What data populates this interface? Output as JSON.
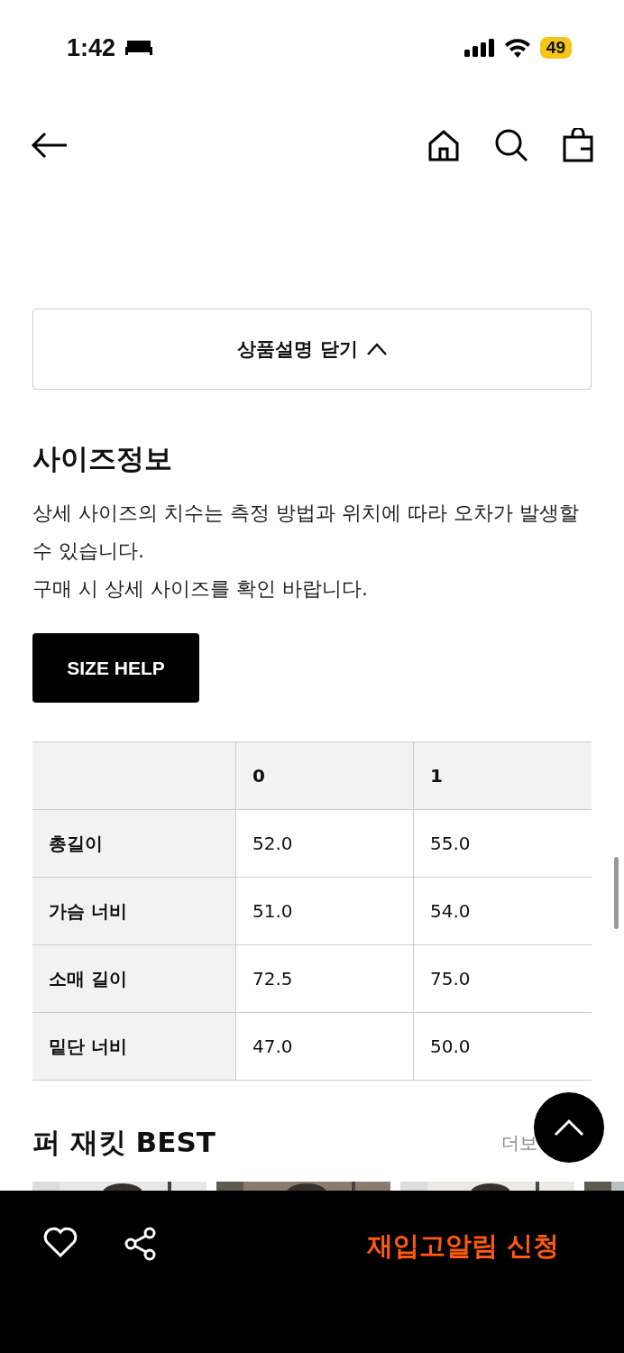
{
  "status_bar": {
    "time": "1:42",
    "battery": "49"
  },
  "collapse_button": {
    "label": "상품설명 닫기"
  },
  "size_info": {
    "title": "사이즈정보",
    "description": [
      "상세 사이즈의 치수는 측정 방법과 위치에 따라 오차가 발생할 수 있습니다.",
      "구매 시 상세 사이즈를 확인 바랍니다."
    ],
    "help_button": "SIZE HELP"
  },
  "table": {
    "columns": [
      "0",
      "1"
    ],
    "rows": [
      {
        "label": "총길이",
        "values": [
          "52.0",
          "55.0"
        ]
      },
      {
        "label": "가슴 너비",
        "values": [
          "51.0",
          "54.0"
        ]
      },
      {
        "label": "소매 길이",
        "values": [
          "72.5",
          "75.0"
        ]
      },
      {
        "label": "밑단 너비",
        "values": [
          "47.0",
          "50.0"
        ]
      }
    ]
  },
  "best": {
    "title": "퍼 재킷 BEST",
    "more": "더보"
  },
  "bottom_bar": {
    "action": "재입고알림 신청"
  }
}
